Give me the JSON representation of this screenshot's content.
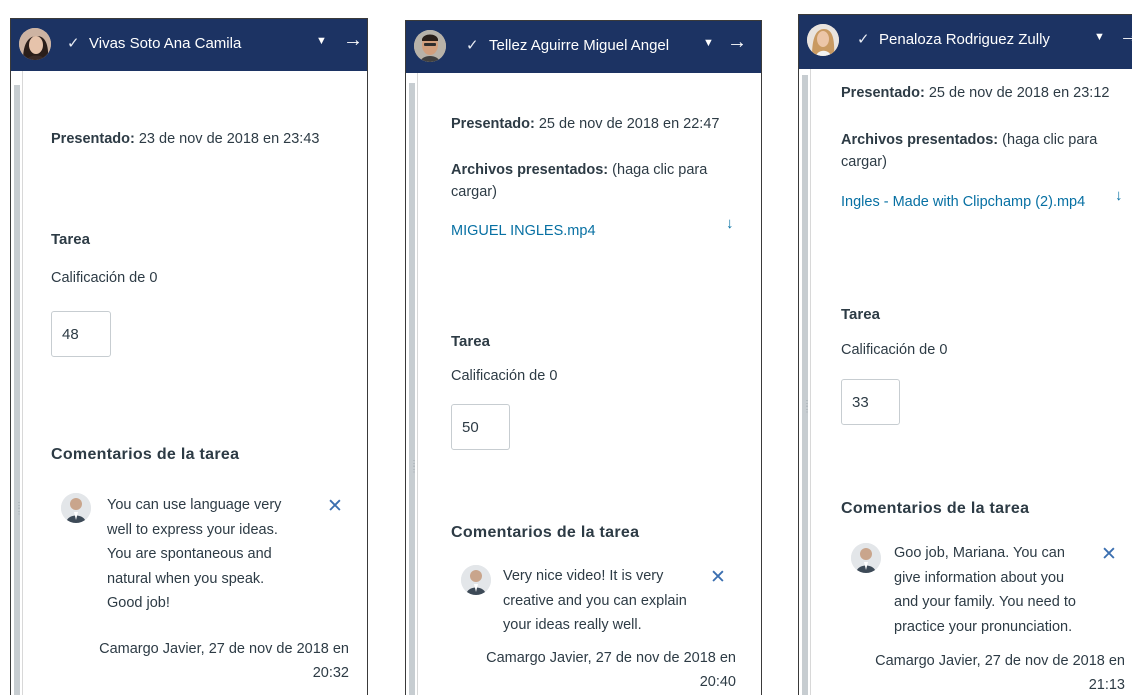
{
  "panels": [
    {
      "student_name": "Vivas Soto Ana Camila",
      "submitted_label": "Presentado:",
      "submitted_date": "23 de nov de 2018 en 23:43",
      "assignment_title": "Tarea",
      "grade_label": "Calificación de 0",
      "grade_value": "48",
      "comments_title": "Comentarios de la tarea",
      "comment": {
        "lines": [
          "You can use language very",
          "well to express your ideas.",
          "You are spontaneous and",
          "natural when you speak.",
          "Good job!"
        ],
        "author_lines": [
          "Camargo Javier, 27 de nov de 2018 en",
          "20:32"
        ]
      }
    },
    {
      "student_name": "Tellez Aguirre Miguel Angel",
      "submitted_label": "Presentado:",
      "submitted_date": "25 de nov de 2018 en 22:47",
      "files_label": "Archivos presentados:",
      "files_hint": "(haga clic para cargar)",
      "file_name": "MIGUEL INGLES.mp4",
      "assignment_title": "Tarea",
      "grade_label": "Calificación de 0",
      "grade_value": "50",
      "comments_title": "Comentarios de la tarea",
      "comment": {
        "lines": [
          "Very nice video! It is very",
          "creative and you can explain",
          "your ideas really well."
        ],
        "author_lines": [
          "Camargo Javier, 27 de nov de 2018 en",
          "20:40"
        ]
      }
    },
    {
      "student_name": "Penaloza Rodriguez Zully",
      "submitted_label": "Presentado:",
      "submitted_date": "25 de nov de 2018 en 23:12",
      "files_label": "Archivos presentados:",
      "files_hint": "(haga clic para cargar)",
      "file_name": "Ingles - Made with Clipchamp (2).mp4",
      "assignment_title": "Tarea",
      "grade_label": "Calificación de 0",
      "grade_value": "33",
      "comments_title": "Comentarios de la tarea",
      "comment": {
        "lines": [
          "Goo job, Mariana. You can",
          "give information about you",
          "and your family. You need to",
          "practice your pronunciation."
        ],
        "author_lines": [
          "Camargo Javier, 27 de nov de 2018 en",
          "21:13"
        ]
      }
    }
  ],
  "icons": {
    "check": "✓",
    "dropdown": "▼",
    "next": "→",
    "download": "↓",
    "delete": "✕"
  },
  "colors": {
    "header_bg": "#1c3363",
    "link": "#0770a3",
    "text": "#2d3b45",
    "delete_icon": "#3b6fb0"
  }
}
